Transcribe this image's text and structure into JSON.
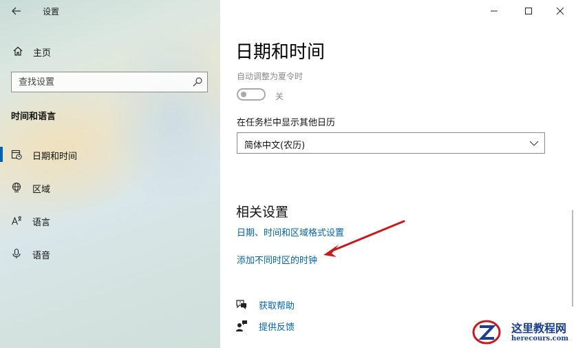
{
  "window": {
    "title": "设置"
  },
  "sidebar": {
    "home_label": "主页",
    "search_placeholder": "查找设置",
    "section_title": "时间和语言",
    "items": [
      {
        "label": "日期和时间",
        "icon": "date-time-icon",
        "active": true
      },
      {
        "label": "区域",
        "icon": "region-globe-icon",
        "active": false
      },
      {
        "label": "语言",
        "icon": "language-icon",
        "active": false
      },
      {
        "label": "语音",
        "icon": "microphone-icon",
        "active": false
      }
    ]
  },
  "main": {
    "page_title": "日期和时间",
    "dst": {
      "label": "自动调整为夏令时",
      "state": "关"
    },
    "calendar": {
      "label": "在任务栏中显示其他日历",
      "selected": "简体中文(农历)"
    },
    "related": {
      "title": "相关设置",
      "links": [
        "日期、时间和区域格式设置",
        "添加不同时区的时钟"
      ]
    },
    "help": {
      "get_help": "获取帮助",
      "feedback": "提供反馈"
    }
  },
  "watermark": {
    "name": "这里教程网",
    "url": "herecours.com"
  },
  "colors": {
    "accent": "#0063b1",
    "arrow": "#c8191d",
    "watermark": "#1b3f8f"
  }
}
